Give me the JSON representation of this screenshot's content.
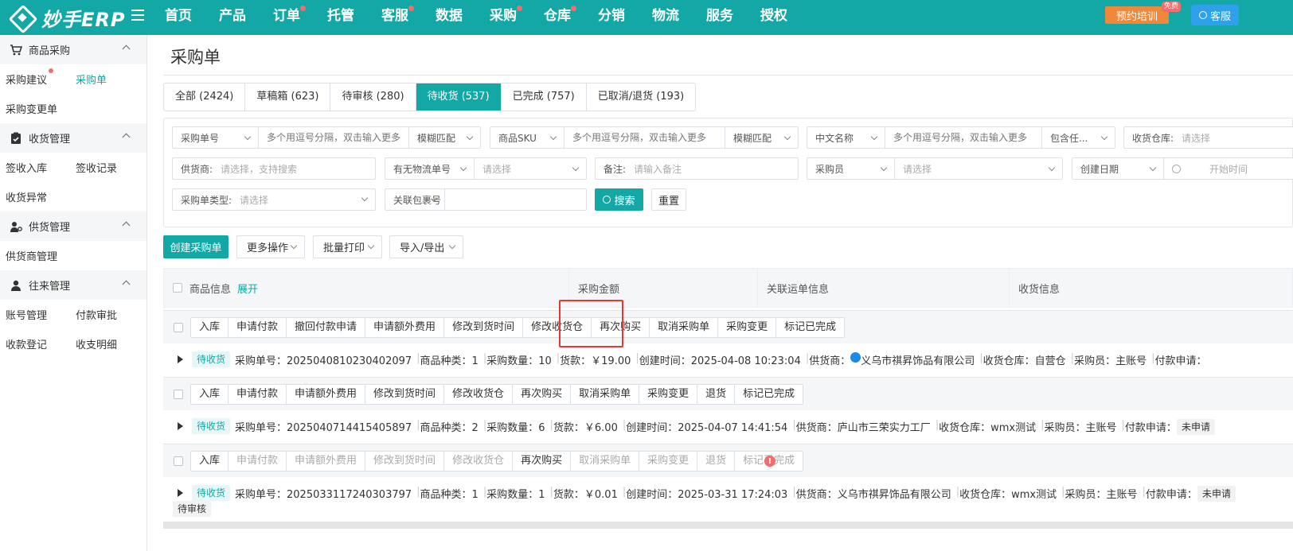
{
  "brand": {
    "name": "妙手ERP"
  },
  "nav": {
    "items": [
      {
        "label": "首页",
        "dot": false
      },
      {
        "label": "产品",
        "dot": false
      },
      {
        "label": "订单",
        "dot": true
      },
      {
        "label": "托管",
        "dot": false
      },
      {
        "label": "客服",
        "dot": true
      },
      {
        "label": "数据",
        "dot": false
      },
      {
        "label": "采购",
        "dot": true
      },
      {
        "label": "仓库",
        "dot": true
      },
      {
        "label": "分销",
        "dot": false
      },
      {
        "label": "物流",
        "dot": false
      },
      {
        "label": "服务",
        "dot": false
      },
      {
        "label": "授权",
        "dot": false
      }
    ],
    "training_label": "预约培训",
    "free_tag": "免费",
    "service_label": "客服"
  },
  "sidebar": {
    "groups": [
      {
        "title": "商品采购",
        "icon": "cart-icon",
        "rows": [
          [
            "采购建议",
            "采购单"
          ],
          [
            "采购变更单"
          ]
        ]
      },
      {
        "title": "收货管理",
        "icon": "clipboard-check-icon",
        "rows": [
          [
            "签收入库",
            "签收记录"
          ],
          [
            "收货异常"
          ]
        ]
      },
      {
        "title": "供货管理",
        "icon": "supplier-icon",
        "rows": [
          [
            "供货商管理"
          ]
        ]
      },
      {
        "title": "往来管理",
        "icon": "user-icon",
        "rows": [
          [
            "账号管理",
            "付款审批"
          ],
          [
            "收款登记",
            "收支明细"
          ]
        ]
      }
    ],
    "active_item": "采购单"
  },
  "page": {
    "title": "采购单"
  },
  "tabs": [
    {
      "label": "全部 (2424)",
      "active": false
    },
    {
      "label": "草稿箱 (623)",
      "active": false
    },
    {
      "label": "待审核 (280)",
      "active": false
    },
    {
      "label": "待收货 (537)",
      "active": true
    },
    {
      "label": "已完成 (757)",
      "active": false
    },
    {
      "label": "已取消/退货 (193)",
      "active": false
    }
  ],
  "filters": {
    "po_no_select": "采购单号",
    "po_no_placeholder": "多个用逗号分隔，双击输入更多",
    "po_no_match": "模糊匹配",
    "sku_select": "商品SKU",
    "sku_placeholder": "多个用逗号分隔，双击输入更多",
    "sku_match": "模糊匹配",
    "name_select": "中文名称",
    "name_placeholder": "多个用逗号分隔，双击输入更多",
    "name_match": "包含任...",
    "warehouse_label": "收货仓库:",
    "warehouse_placeholder": "请选择",
    "supplier_label": "供货商:",
    "supplier_placeholder": "请选择，支持搜索",
    "logistics_select": "有无物流单号",
    "logistics_placeholder": "请选择",
    "remark_label": "备注:",
    "remark_placeholder": "请输入备注",
    "buyer_select": "采购员",
    "buyer_placeholder": "请选择",
    "date_select": "创建日期",
    "date_placeholder": "开始时间",
    "type_label": "采购单类型:",
    "type_placeholder": "请选择",
    "package_select": "关联包裹号",
    "search_label": "搜索",
    "reset_label": "重置"
  },
  "actions": {
    "create": "创建采购单",
    "more": "更多操作",
    "print": "批量打印",
    "import_export": "导入/导出"
  },
  "table": {
    "headers": [
      "商品信息",
      "采购金额",
      "关联运单信息",
      "收货信息"
    ],
    "expand_label": "展开"
  },
  "orders": [
    {
      "ops": [
        {
          "label": "入库",
          "disabled": false
        },
        {
          "label": "申请付款",
          "disabled": false
        },
        {
          "label": "撤回付款申请",
          "disabled": false
        },
        {
          "label": "申请额外费用",
          "disabled": false
        },
        {
          "label": "修改到货时间",
          "disabled": false
        },
        {
          "label": "修改收货仓",
          "disabled": false
        },
        {
          "label": "再次购买",
          "disabled": false
        },
        {
          "label": "取消采购单",
          "disabled": false
        },
        {
          "label": "采购变更",
          "disabled": false
        },
        {
          "label": "标记已完成",
          "disabled": false
        }
      ],
      "status": "待收货",
      "po_no": "采购单号：2025040810230402097",
      "kinds": "商品种类：1",
      "qty": "采购数量：10",
      "amount": "货款：￥19.00",
      "created": "创建时间：2025-04-08 10:23:04",
      "supplier_label": "供货商：",
      "supplier": "义乌市祺昇饰品有限公司",
      "warehouse": "收货仓库：自营仓",
      "buyer": "采购员：主账号",
      "payment": "付款申请："
    },
    {
      "ops": [
        {
          "label": "入库",
          "disabled": false
        },
        {
          "label": "申请付款",
          "disabled": false
        },
        {
          "label": "申请额外费用",
          "disabled": false
        },
        {
          "label": "修改到货时间",
          "disabled": false
        },
        {
          "label": "修改收货仓",
          "disabled": false
        },
        {
          "label": "再次购买",
          "disabled": false
        },
        {
          "label": "取消采购单",
          "disabled": false
        },
        {
          "label": "采购变更",
          "disabled": false
        },
        {
          "label": "退货",
          "disabled": false
        },
        {
          "label": "标记已完成",
          "disabled": false
        }
      ],
      "status": "待收货",
      "po_no": "采购单号：2025040714415405897",
      "kinds": "商品种类：2",
      "qty": "采购数量：6",
      "amount": "货款：￥6.00",
      "created": "创建时间：2025-04-07 14:41:54",
      "supplier_label": "供货商：",
      "supplier": "庐山市三荣实力工厂",
      "warehouse": "收货仓库：wmx测试",
      "buyer": "采购员：主账号",
      "payment": "付款申请：",
      "payment_tag": "未申请"
    },
    {
      "ops": [
        {
          "label": "入库",
          "disabled": false
        },
        {
          "label": "申请付款",
          "disabled": true
        },
        {
          "label": "申请额外费用",
          "disabled": true
        },
        {
          "label": "修改到货时间",
          "disabled": true
        },
        {
          "label": "修改收货仓",
          "disabled": true
        },
        {
          "label": "再次购买",
          "disabled": false
        },
        {
          "label": "取消采购单",
          "disabled": true
        },
        {
          "label": "采购变更",
          "disabled": true
        },
        {
          "label": "退货",
          "disabled": true
        },
        {
          "label": "标记已完成",
          "disabled": true
        }
      ],
      "status": "待收货",
      "po_no": "采购单号：2025033117240303797",
      "kinds": "商品种类：1",
      "qty": "采购数量：1",
      "amount": "货款：￥0.01",
      "created": "创建时间：2025-03-31 17:24:03",
      "supplier_label": "供货商：",
      "supplier": "义乌市祺昇饰品有限公司",
      "warehouse": "收货仓库：wmx测试",
      "buyer": "采购员：主账号",
      "payment": "付款申请：",
      "payment_tag": "未申请",
      "extra_tag": "待审核"
    }
  ],
  "colors": {
    "accent": "#13a8a6",
    "danger": "#f56c6c",
    "highlight": "#e53935"
  }
}
